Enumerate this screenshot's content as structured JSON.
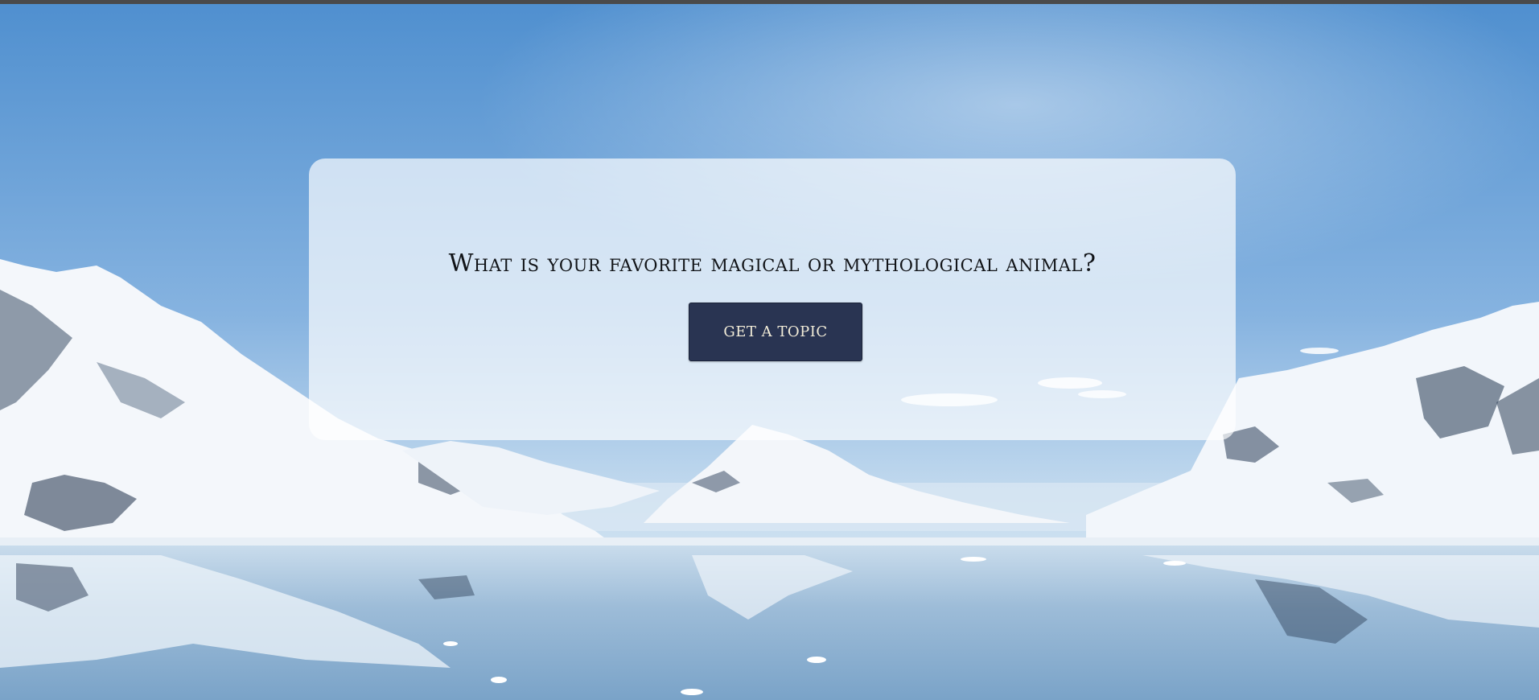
{
  "prompt": {
    "question": "What is your favorite magical or mythological animal?",
    "button_label": "GET A TOPIC"
  },
  "background": {
    "icon": "snowy-mountains-lake-photo"
  },
  "colors": {
    "button_bg": "#293452",
    "button_text": "#f2ecd8",
    "card_bg": "rgba(255,255,255,0.68)",
    "sky": "#6fa3d6"
  }
}
